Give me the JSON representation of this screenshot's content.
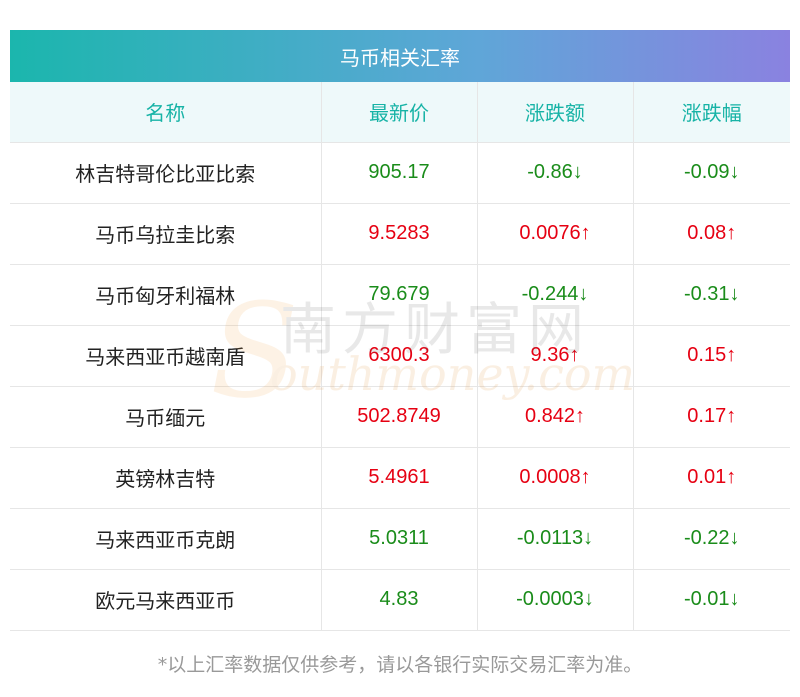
{
  "title": "马币相关汇率",
  "columns": [
    "名称",
    "最新价",
    "涨跌额",
    "涨跌幅"
  ],
  "rows": [
    {
      "name": "林吉特哥伦比亚比索",
      "price": "905.17",
      "change": "-0.86↓",
      "pct": "-0.09↓",
      "dir": "down"
    },
    {
      "name": "马币乌拉圭比索",
      "price": "9.5283",
      "change": "0.0076↑",
      "pct": "0.08↑",
      "dir": "up"
    },
    {
      "name": "马币匈牙利福林",
      "price": "79.679",
      "change": "-0.244↓",
      "pct": "-0.31↓",
      "dir": "down"
    },
    {
      "name": "马来西亚币越南盾",
      "price": "6300.3",
      "change": "9.36↑",
      "pct": "0.15↑",
      "dir": "up"
    },
    {
      "name": "马币缅元",
      "price": "502.8749",
      "change": "0.842↑",
      "pct": "0.17↑",
      "dir": "up"
    },
    {
      "name": "英镑林吉特",
      "price": "5.4961",
      "change": "0.0008↑",
      "pct": "0.01↑",
      "dir": "up"
    },
    {
      "name": "马来西亚币克朗",
      "price": "5.0311",
      "change": "-0.0113↓",
      "pct": "-0.22↓",
      "dir": "down"
    },
    {
      "name": "欧元马来西亚币",
      "price": "4.83",
      "change": "-0.0003↓",
      "pct": "-0.01↓",
      "dir": "down"
    }
  ],
  "watermark": {
    "cn": "南方财富网",
    "en": "outhmoney.com",
    "s": "S"
  },
  "footnote": "*以上汇率数据仅供参考，请以各银行实际交易汇率为准。",
  "colors": {
    "up": "#e60012",
    "down": "#1a8c1a",
    "header_text": "#17b3a6"
  }
}
